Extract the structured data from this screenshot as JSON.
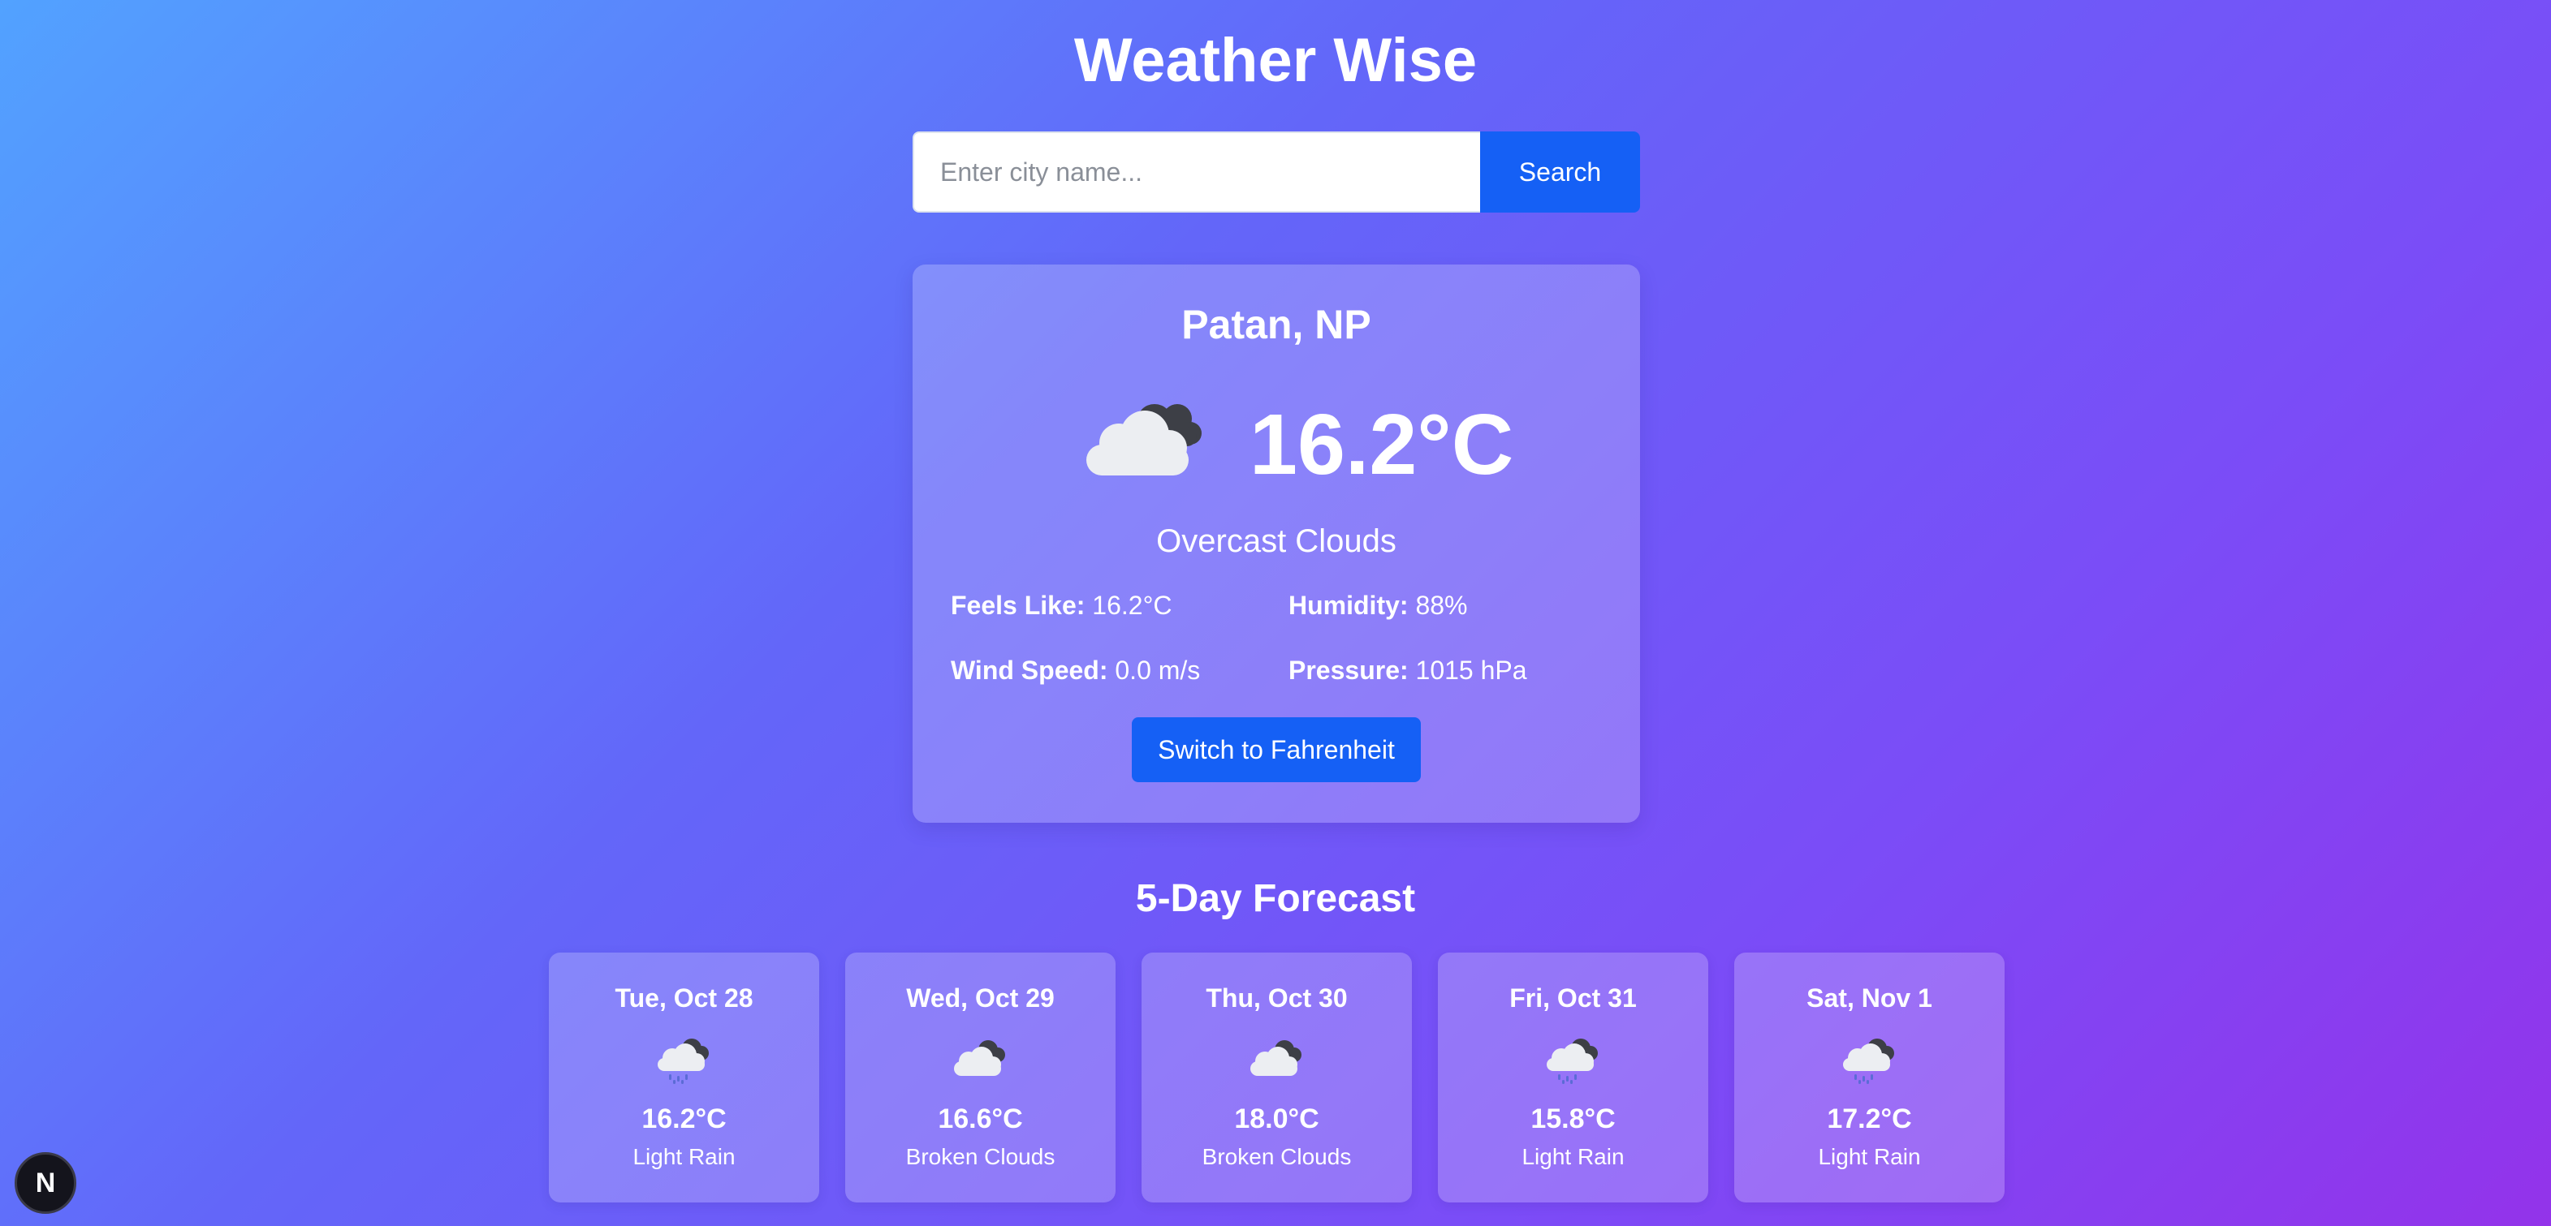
{
  "app": {
    "title": "Weather Wise"
  },
  "search": {
    "placeholder": "Enter city name...",
    "value": "",
    "button_label": "Search"
  },
  "current": {
    "location": "Patan, NP",
    "icon": "broken-clouds-icon",
    "temperature": "16.2°C",
    "condition": "Overcast Clouds",
    "details": [
      {
        "label": "Feels Like:",
        "value": "16.2°C"
      },
      {
        "label": "Humidity:",
        "value": "88%"
      },
      {
        "label": "Wind Speed:",
        "value": "0.0 m/s"
      },
      {
        "label": "Pressure:",
        "value": "1015 hPa"
      }
    ],
    "toggle_label": "Switch to Fahrenheit"
  },
  "forecast": {
    "title": "5-Day Forecast",
    "days": [
      {
        "date": "Tue, Oct 28",
        "icon": "rain-cloud-icon",
        "temp": "16.2°C",
        "desc": "Light Rain"
      },
      {
        "date": "Wed, Oct 29",
        "icon": "broken-clouds-icon",
        "temp": "16.6°C",
        "desc": "Broken Clouds"
      },
      {
        "date": "Thu, Oct 30",
        "icon": "broken-clouds-icon",
        "temp": "18.0°C",
        "desc": "Broken Clouds"
      },
      {
        "date": "Fri, Oct 31",
        "icon": "rain-cloud-icon",
        "temp": "15.8°C",
        "desc": "Light Rain"
      },
      {
        "date": "Sat, Nov 1",
        "icon": "rain-cloud-icon",
        "temp": "17.2°C",
        "desc": "Light Rain"
      }
    ]
  },
  "badge": {
    "letter": "N",
    "icon": "nextjs-logo-icon"
  },
  "colors": {
    "accent": "#1560f5",
    "background_start": "#52a2ff",
    "background_end": "#9333ea"
  }
}
